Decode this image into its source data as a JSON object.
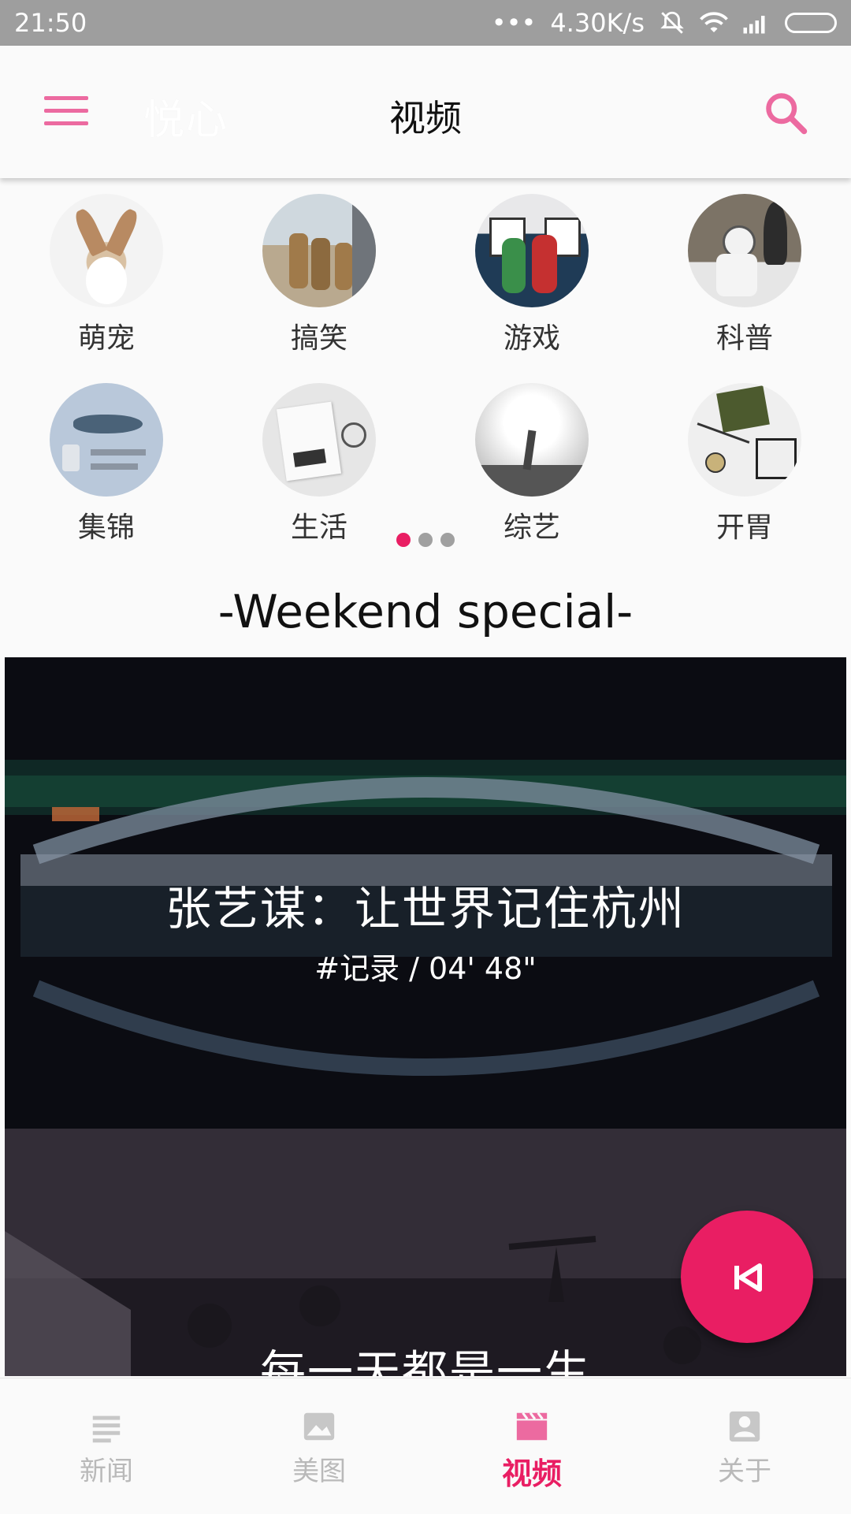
{
  "status_bar": {
    "time": "21:50",
    "net_speed": "4.30K/s",
    "icons": [
      "more-dots-icon",
      "mute-bell-icon",
      "wifi-icon",
      "signal-icon",
      "battery-icon"
    ]
  },
  "app_bar": {
    "brand": "悦心",
    "title": "视频",
    "icons": [
      "menu-icon",
      "search-icon"
    ],
    "accent": "#e91e63"
  },
  "categories": [
    {
      "label": "萌宠"
    },
    {
      "label": "搞笑"
    },
    {
      "label": "游戏"
    },
    {
      "label": "科普"
    },
    {
      "label": "集锦"
    },
    {
      "label": "生活"
    },
    {
      "label": "综艺"
    },
    {
      "label": "开胃"
    }
  ],
  "pager": {
    "count": 3,
    "active": 0
  },
  "section_title": "-Weekend  special-",
  "videos": [
    {
      "title": "张艺谋：让世界记住杭州",
      "meta": "#记录  /  04' 48\""
    },
    {
      "title": "每一天都是一生",
      "meta": ""
    }
  ],
  "fab": {
    "icon": "skip-previous-icon"
  },
  "bottom_nav": [
    {
      "label": "新闻",
      "icon": "news-icon",
      "active": false
    },
    {
      "label": "美图",
      "icon": "image-icon",
      "active": false
    },
    {
      "label": "视频",
      "icon": "clapperboard-icon",
      "active": true
    },
    {
      "label": "关于",
      "icon": "account-icon",
      "active": false
    }
  ]
}
